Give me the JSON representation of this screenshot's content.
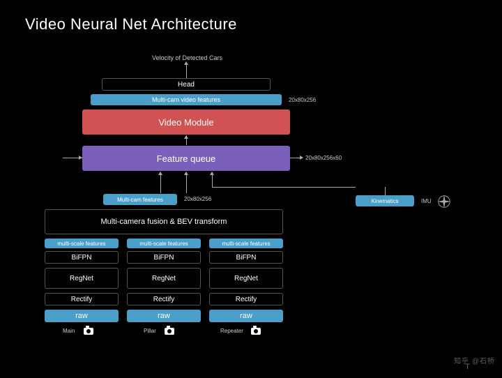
{
  "title": "Video Neural Net Architecture",
  "top": {
    "output_label": "Velocity of Detected Cars",
    "head": "Head",
    "mcvf": "Multi-cam video features",
    "mcvf_dim": "20x80x256",
    "video_module": "Video Module",
    "feature_queue": "Feature queue",
    "fq_dim": "20x80x256x60"
  },
  "mid": {
    "mcf": "Multi-cam features",
    "mcf_dim": "20x80x256",
    "kinematics": "Kinematics",
    "imu": "IMU"
  },
  "fusion": {
    "title": "Multi-camera fusion & BEV transform"
  },
  "columns": {
    "msf": "multi-scale features",
    "bifpn": "BiFPN",
    "regnet": "RegNet",
    "rectify": "Rectify",
    "raw": "raw",
    "names": [
      "Main",
      "Pillar",
      "Repeater"
    ]
  },
  "watermark": "知乎 @石桥",
  "brand": "T"
}
